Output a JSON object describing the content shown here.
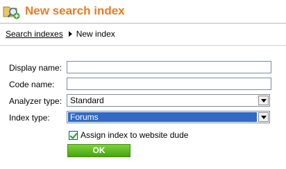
{
  "header": {
    "icon": "folder-search-add-icon",
    "title": "New search index",
    "title_color": "#f07a1e"
  },
  "breadcrumb": {
    "parent": "Search indexes",
    "current": "New index"
  },
  "form": {
    "display_name": {
      "label": "Display name:",
      "value": ""
    },
    "code_name": {
      "label": "Code name:",
      "value": ""
    },
    "analyzer_type": {
      "label": "Analyzer type:",
      "value": "Standard"
    },
    "index_type": {
      "label": "Index type:",
      "value": "Forums"
    },
    "assign_checkbox": {
      "label": "Assign index to website dude",
      "checked": true
    },
    "ok_button": "OK"
  },
  "colors": {
    "ok_button": "#46a512",
    "selection": "#3169c6"
  }
}
